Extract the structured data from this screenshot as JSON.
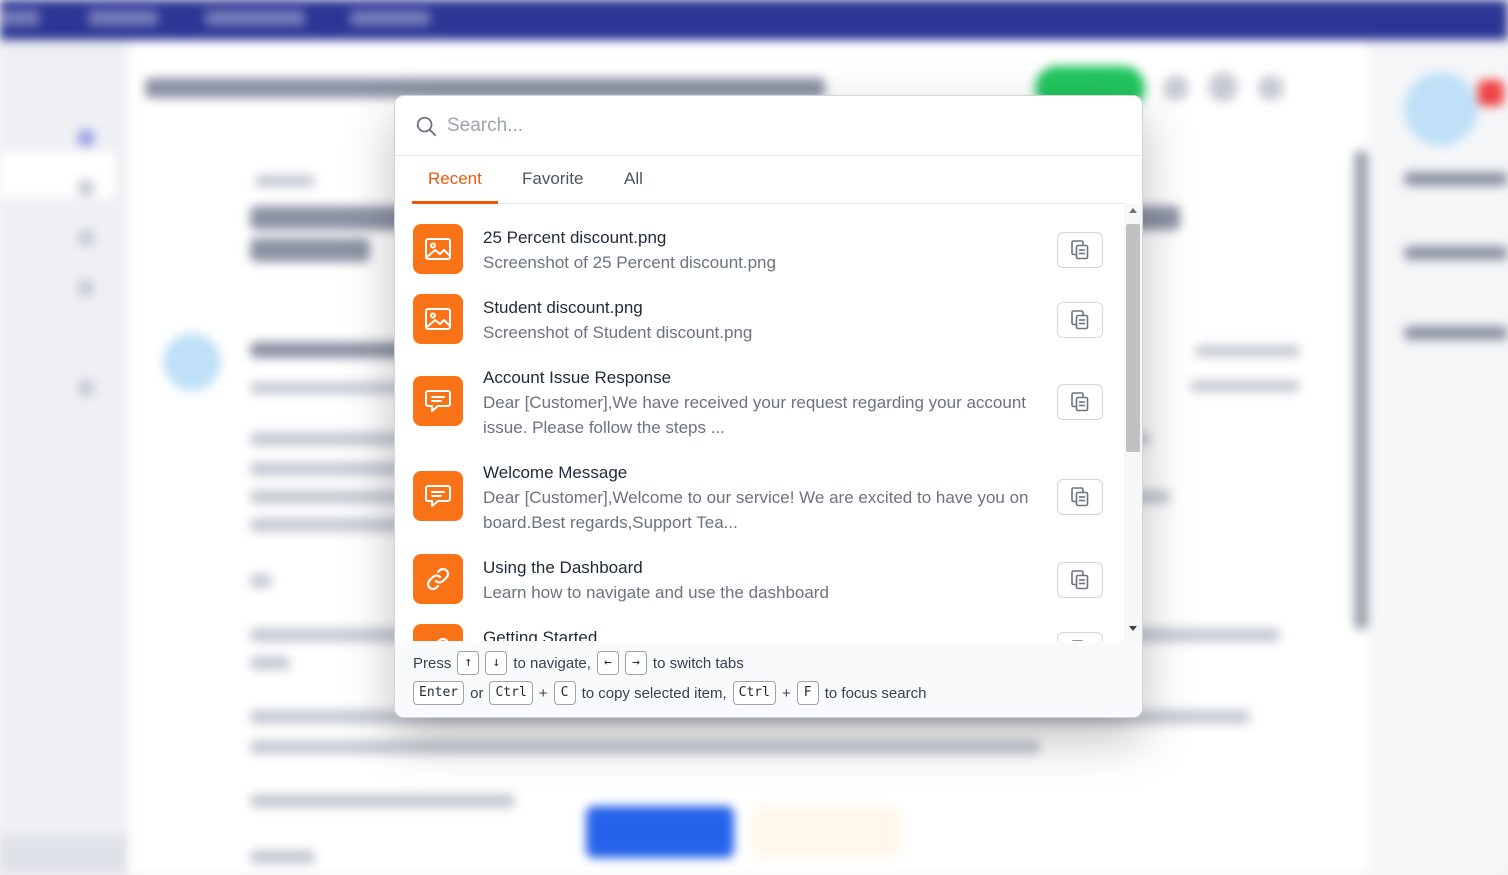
{
  "search": {
    "placeholder": "Search..."
  },
  "tabs": [
    {
      "label": "Recent",
      "active": true
    },
    {
      "label": "Favorite",
      "active": false
    },
    {
      "label": "All",
      "active": false
    }
  ],
  "items": [
    {
      "icon": "image-icon",
      "title": "25 Percent discount.png",
      "description": "Screenshot of 25 Percent discount.png"
    },
    {
      "icon": "image-icon",
      "title": "Student discount.png",
      "description": "Screenshot of Student discount.png"
    },
    {
      "icon": "message-icon",
      "title": "Account Issue Response",
      "description": "Dear [Customer],We have received your request regarding your account issue. Please follow the steps ..."
    },
    {
      "icon": "message-icon",
      "title": "Welcome Message",
      "description": "Dear [Customer],Welcome to our service! We are excited to have you on board.Best regards,Support Tea..."
    },
    {
      "icon": "link-icon",
      "title": "Using the Dashboard",
      "description": "Learn how to navigate and use the dashboard"
    },
    {
      "icon": "link-icon",
      "title": "Getting Started",
      "description": ""
    }
  ],
  "footer": {
    "press": "Press",
    "key_up": "↑",
    "key_down": "↓",
    "to_navigate": "to navigate,",
    "key_left": "←",
    "key_right": "→",
    "to_switch_tabs": "to switch tabs",
    "key_enter": "Enter",
    "or": "or",
    "key_ctrl": "Ctrl",
    "plus": "+",
    "key_c": "C",
    "to_copy": "to copy selected item,",
    "key_f": "F",
    "to_focus": "to focus search"
  },
  "colors": {
    "accent": "#f97316",
    "tab_active": "#ea580c",
    "topbar": "#2b3594"
  }
}
